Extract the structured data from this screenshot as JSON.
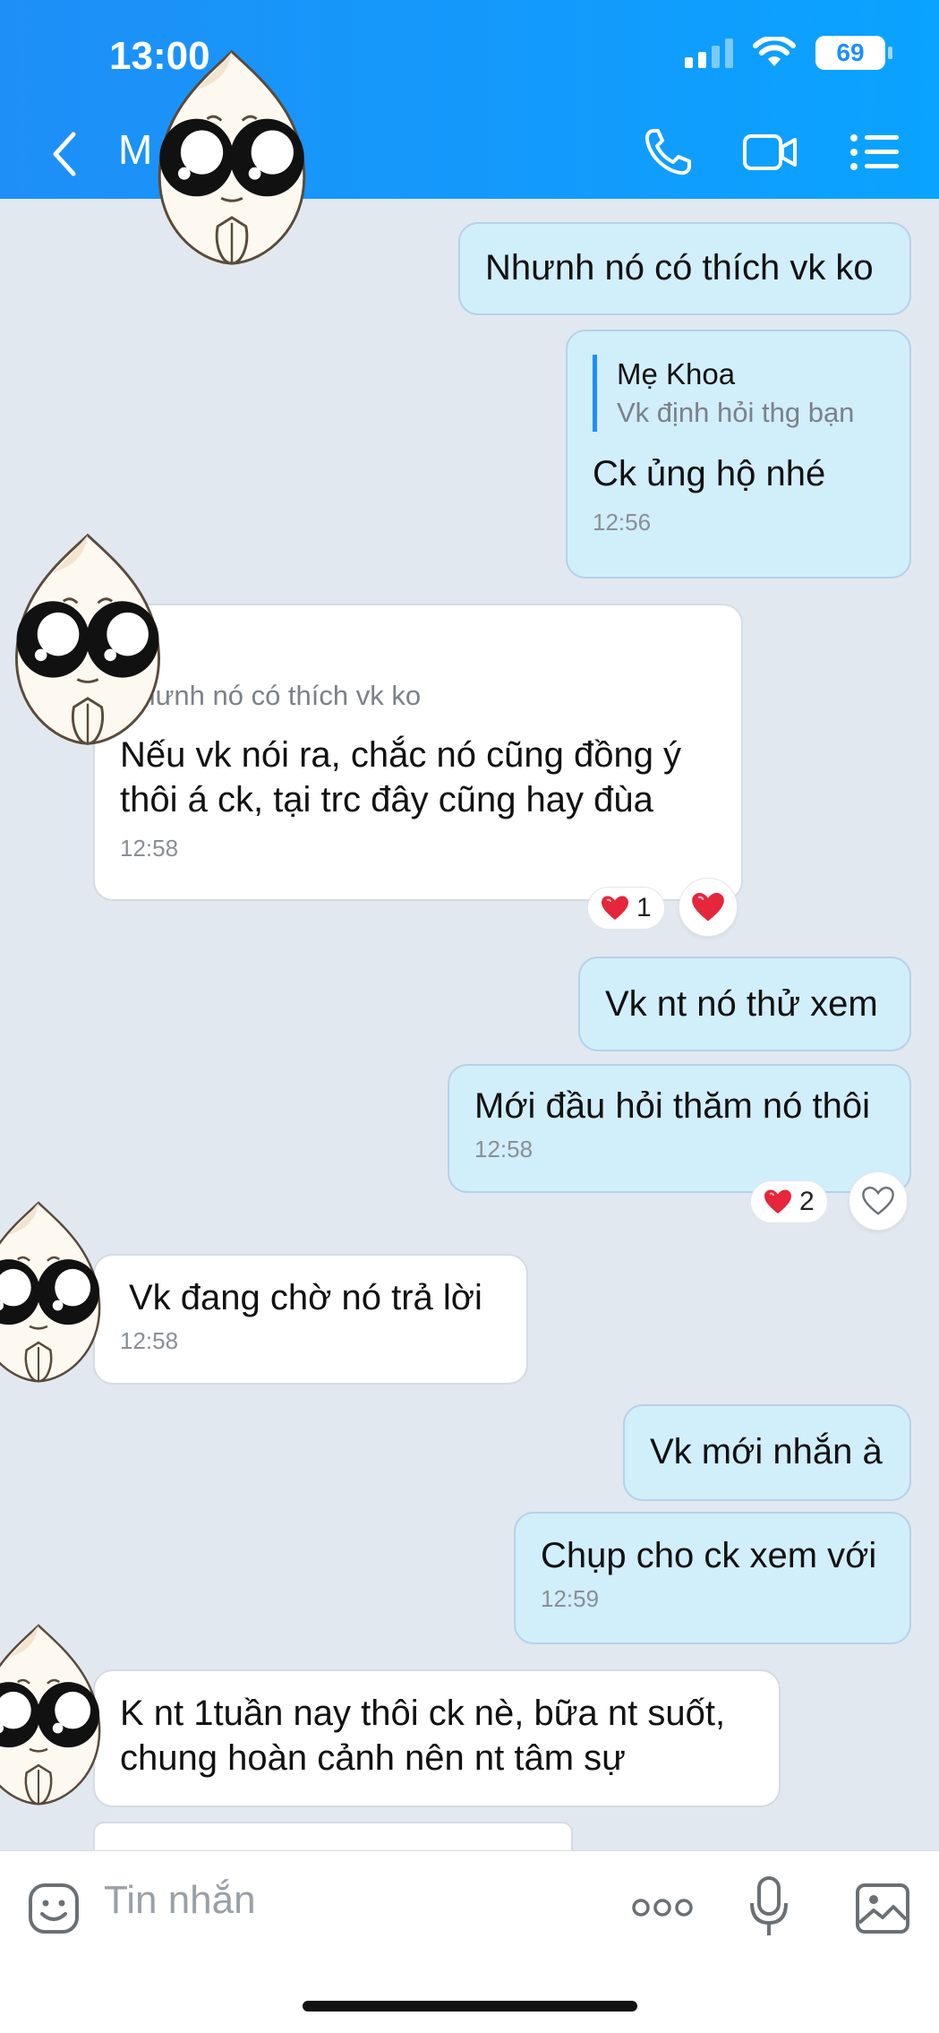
{
  "status_bar": {
    "time": "13:00",
    "battery": "69"
  },
  "header": {
    "contact_name": "M"
  },
  "messages": [
    {
      "side": "me",
      "text": "Nhưnh nó có thích vk ko"
    },
    {
      "side": "me",
      "quote_name": "Mẹ Khoa",
      "quote_text": "Vk định hỏi thg bạn",
      "text": "Ck ủng hộ nhé",
      "time": "12:56"
    },
    {
      "side": "them",
      "quote_text": "Nhưnh nó có thích vk ko",
      "text_line1": "Nếu vk nói ra, chắc nó cũng đồng ý",
      "text_line2": "thôi á ck, tại trc đây cũng hay đùa",
      "time": "12:58",
      "reaction_count": "1"
    },
    {
      "side": "me",
      "text": "Vk nt nó thử xem"
    },
    {
      "side": "me",
      "text": "Mới đầu hỏi thăm nó thôi",
      "time": "12:58",
      "reaction_count": "2"
    },
    {
      "side": "them",
      "text": "Vk đang chờ nó trả lời",
      "time": "12:58"
    },
    {
      "side": "me",
      "text": "Vk mới nhắn à"
    },
    {
      "side": "me",
      "text": "Chụp cho ck xem với",
      "time": "12:59"
    },
    {
      "side": "them",
      "text_line1": "K nt 1tuần nay thôi ck nè, bữa nt suốt,",
      "text_line2": "chung hoàn cảnh nên nt tâm sự"
    }
  ],
  "composer": {
    "placeholder": "Tin nhắn"
  },
  "colors": {
    "header": "#1e8ff7",
    "my_bubble": "#d1eefb",
    "their_bubble": "#ffffff",
    "heart": "#e5263b"
  },
  "icons": [
    "back-icon",
    "phone-icon",
    "video-call-icon",
    "menu-list-icon",
    "sticker-emoji-icon",
    "more-dots-icon",
    "microphone-icon",
    "image-icon",
    "heart-icon"
  ]
}
